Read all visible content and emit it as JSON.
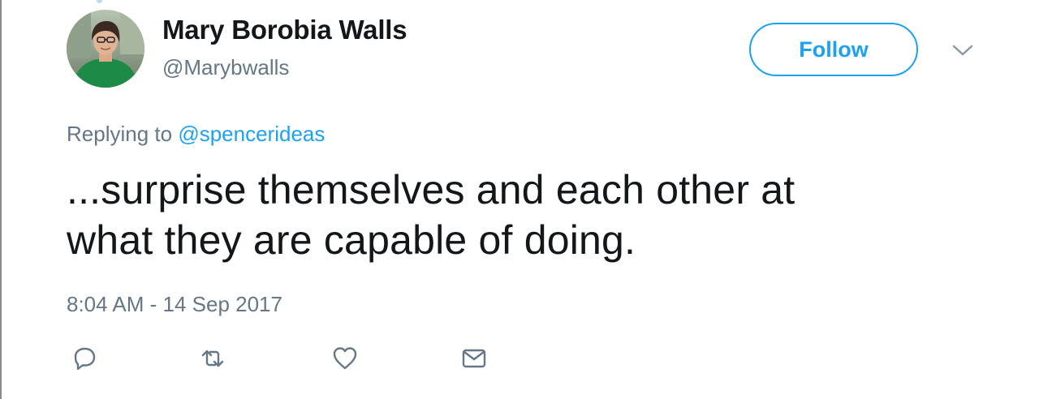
{
  "tweet": {
    "author": {
      "display_name": "Mary Borobia Walls",
      "handle": "@Marybwalls"
    },
    "follow_label": "Follow",
    "reply_prefix": "Replying to",
    "reply_to": "@spencerideas",
    "text_line1": "...surprise themselves and each other at",
    "text_line2": "what they are capable of doing.",
    "timestamp": "8:04 AM - 14 Sep 2017"
  },
  "icons": {
    "caret": "chevron-down-icon",
    "reply": "reply-icon",
    "retweet": "retweet-icon",
    "like": "heart-icon",
    "dm": "envelope-icon"
  },
  "colors": {
    "accent": "#1da1f2",
    "text": "#14171a",
    "muted": "#657786"
  }
}
